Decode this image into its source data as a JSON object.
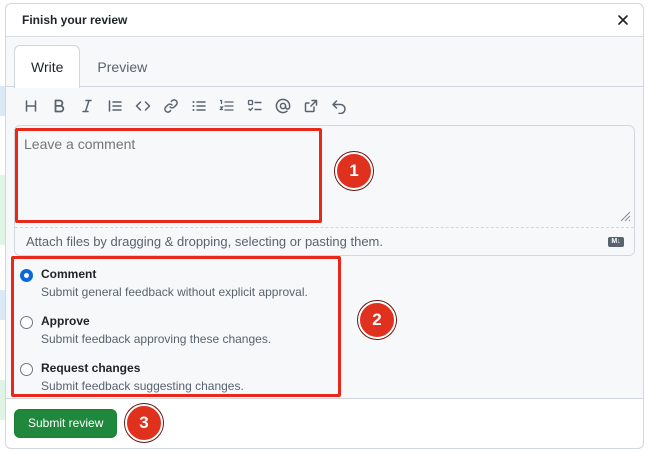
{
  "dialog": {
    "title": "Finish your review"
  },
  "tabs": [
    {
      "label": "Write",
      "active": true
    },
    {
      "label": "Preview",
      "active": false
    }
  ],
  "toolbar": {
    "buttons": [
      {
        "name": "heading-icon"
      },
      {
        "name": "bold-icon"
      },
      {
        "name": "italic-icon"
      },
      {
        "name": "quote-icon"
      },
      {
        "name": "code-icon"
      },
      {
        "name": "link-icon"
      },
      {
        "name": "unordered-list-icon"
      },
      {
        "name": "ordered-list-icon"
      },
      {
        "name": "task-list-icon"
      },
      {
        "name": "mention-icon"
      },
      {
        "name": "cross-reference-icon"
      },
      {
        "name": "undo-icon"
      }
    ]
  },
  "comment": {
    "placeholder": "Leave a comment",
    "attach_hint": "Attach files by dragging & dropping, selecting or pasting them.",
    "markdown_badge": "M↓"
  },
  "review_options": [
    {
      "label": "Comment",
      "description": "Submit general feedback without explicit approval.",
      "checked": true
    },
    {
      "label": "Approve",
      "description": "Submit feedback approving these changes.",
      "checked": false
    },
    {
      "label": "Request changes",
      "description": "Submit feedback suggesting changes.",
      "checked": false
    }
  ],
  "submit": {
    "label": "Submit review",
    "color": "#1f883d"
  },
  "annotations": {
    "badge1": "1",
    "badge2": "2",
    "badge3": "3",
    "color": "#e0301e"
  }
}
